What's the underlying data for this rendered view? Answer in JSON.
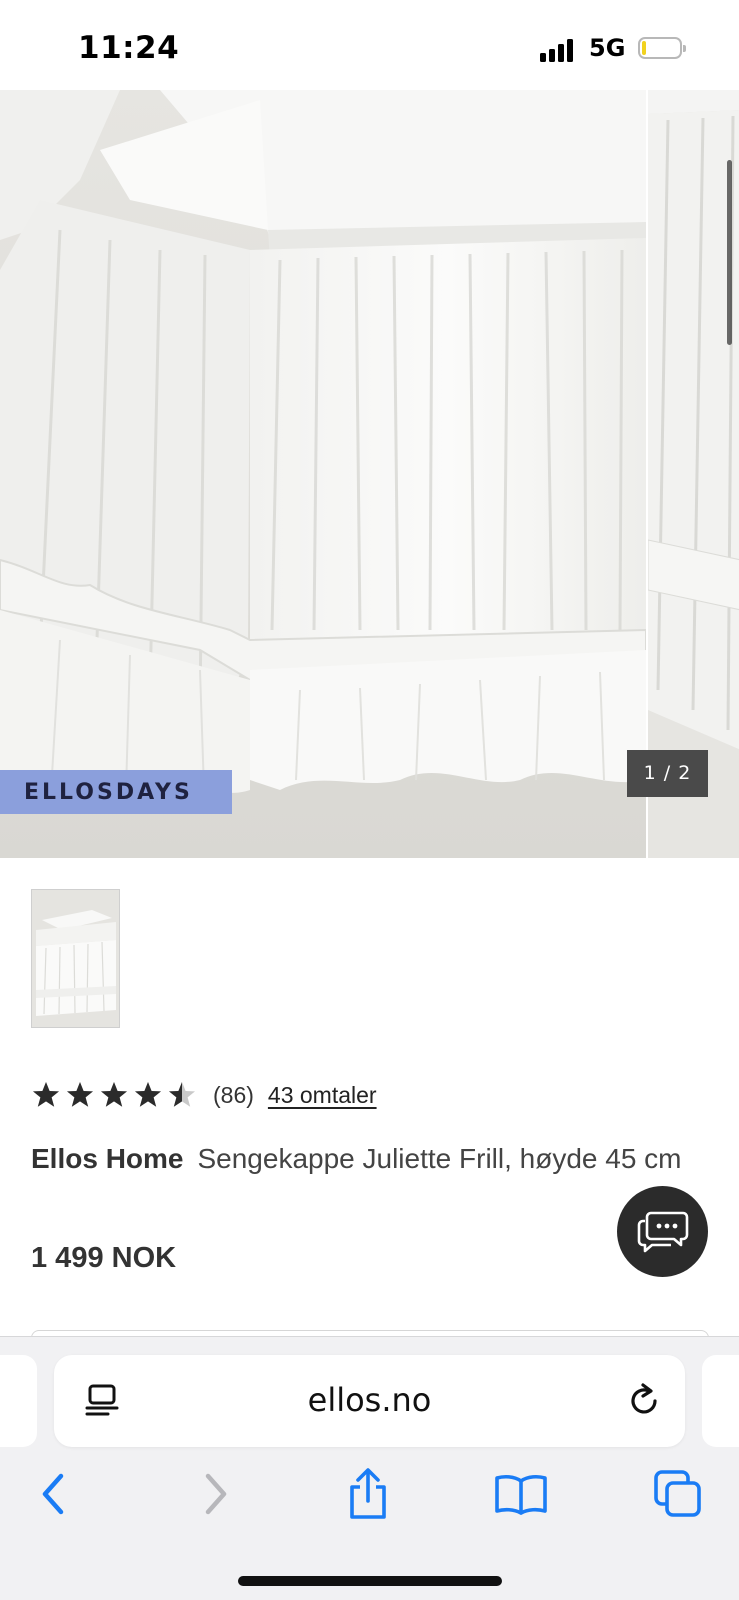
{
  "status_bar": {
    "time": "11:24",
    "network": "5G",
    "battery_level": 0.1
  },
  "gallery": {
    "badge": "ELLOSDAYS",
    "counter": "1 / 2"
  },
  "product": {
    "rating_value": 4.5,
    "rating_count": "(86)",
    "reviews_link": "43 omtaler",
    "brand": "Ellos Home",
    "name": "Sengekappe Juliette Frill, høyde 45 cm",
    "price": "1 499 NOK"
  },
  "browser": {
    "url": "ellos.no"
  },
  "colors": {
    "badge_bg": "#8b9fdc",
    "link_blue": "#1a7cf5",
    "toolbar_bg": "#f1f1f3"
  },
  "icons": {
    "chat": "chat-bubbles-icon",
    "reader": "reader-mode-icon",
    "reload": "reload-icon",
    "back": "chevron-left-icon",
    "forward": "chevron-right-icon",
    "share": "share-icon",
    "bookmarks": "book-icon",
    "tabs": "tabs-icon"
  }
}
